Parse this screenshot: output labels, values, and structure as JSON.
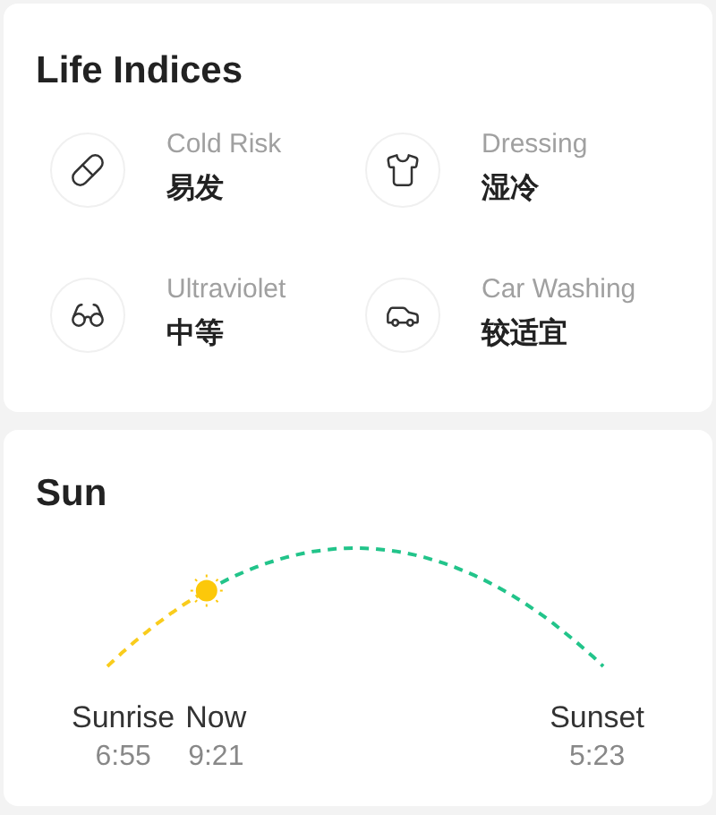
{
  "life_indices": {
    "title": "Life Indices",
    "items": [
      {
        "label": "Cold Risk",
        "value": "易发"
      },
      {
        "label": "Dressing",
        "value": "湿冷"
      },
      {
        "label": "Ultraviolet",
        "value": "中等"
      },
      {
        "label": "Car Washing",
        "value": "较适宜"
      }
    ]
  },
  "sun": {
    "title": "Sun",
    "sunrise": {
      "label": "Sunrise",
      "time": "6:55"
    },
    "now": {
      "label": "Now",
      "time": "9:21"
    },
    "sunset": {
      "label": "Sunset",
      "time": "5:23"
    }
  }
}
